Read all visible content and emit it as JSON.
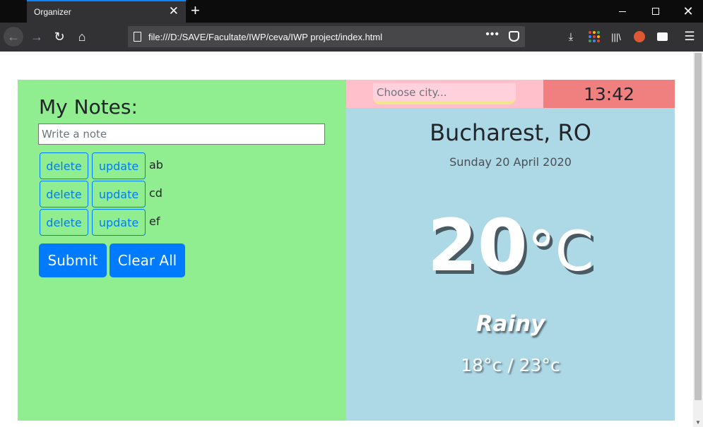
{
  "browser": {
    "tab_title": "Organizer",
    "url": "file:///D:/SAVE/Facultate/IWP/ceva/IWP project/index.html",
    "accent_color": "#0a84ff"
  },
  "notes": {
    "title": "My Notes:",
    "input_placeholder": "Write a note",
    "delete_label": "delete",
    "update_label": "update",
    "items": [
      {
        "text": "ab"
      },
      {
        "text": "cd"
      },
      {
        "text": "ef"
      }
    ],
    "submit_label": "Submit",
    "clear_label": "Clear All",
    "panel_color": "#90ee90",
    "button_color": "#007bff"
  },
  "weather": {
    "city_placeholder": "Choose city...",
    "time": "13:42",
    "city": "Bucharest, RO",
    "date": "Sunday 20 April 2020",
    "temperature": "20",
    "unit": "°C",
    "condition": "Rainy",
    "hi_lo": "18°c / 23°c",
    "panel_color": "#add8e6",
    "city_bar_color": "#ffc0cb",
    "clock_color": "#f08080"
  }
}
